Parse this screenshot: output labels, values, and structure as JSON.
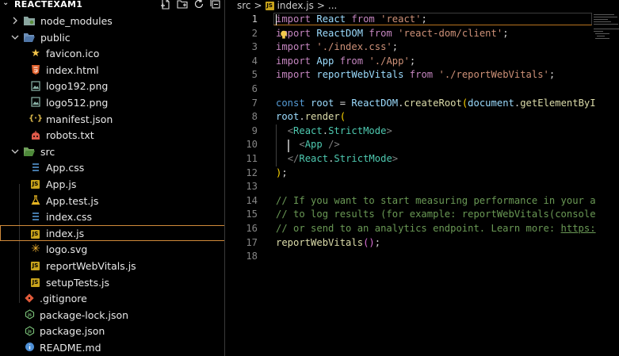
{
  "explorer": {
    "title": "REACTEXAM1",
    "actions": [
      "new-file-icon",
      "new-folder-icon",
      "refresh-icon",
      "collapse-all-icon"
    ],
    "items": [
      {
        "label": "node_modules",
        "kind": "folder",
        "state": "collapsed",
        "depth": 0
      },
      {
        "label": "public",
        "kind": "folder",
        "state": "expanded",
        "depth": 0
      },
      {
        "label": "favicon.ico",
        "kind": "file",
        "icon": "star-icon",
        "depth": 1
      },
      {
        "label": "index.html",
        "kind": "file",
        "icon": "html-icon",
        "depth": 1
      },
      {
        "label": "logo192.png",
        "kind": "file",
        "icon": "image-icon",
        "depth": 1
      },
      {
        "label": "logo512.png",
        "kind": "file",
        "icon": "image-icon",
        "depth": 1
      },
      {
        "label": "manifest.json",
        "kind": "file",
        "icon": "json-icon",
        "depth": 1
      },
      {
        "label": "robots.txt",
        "kind": "file",
        "icon": "robot-icon",
        "depth": 1
      },
      {
        "label": "src",
        "kind": "folder",
        "state": "expanded",
        "depth": 0
      },
      {
        "label": "App.css",
        "kind": "file",
        "icon": "css-icon",
        "depth": 1
      },
      {
        "label": "App.js",
        "kind": "file",
        "icon": "js-icon",
        "depth": 1
      },
      {
        "label": "App.test.js",
        "kind": "file",
        "icon": "test-icon",
        "depth": 1
      },
      {
        "label": "index.css",
        "kind": "file",
        "icon": "css-icon",
        "depth": 1
      },
      {
        "label": "index.js",
        "kind": "file",
        "icon": "js-icon",
        "depth": 1,
        "selected": true
      },
      {
        "label": "logo.svg",
        "kind": "file",
        "icon": "svg-icon",
        "depth": 1
      },
      {
        "label": "reportWebVitals.js",
        "kind": "file",
        "icon": "js-icon",
        "depth": 1
      },
      {
        "label": "setupTests.js",
        "kind": "file",
        "icon": "js-icon",
        "depth": 1
      },
      {
        "label": ".gitignore",
        "kind": "file",
        "icon": "git-icon",
        "depth": 0
      },
      {
        "label": "package-lock.json",
        "kind": "file",
        "icon": "npm-icon",
        "depth": 0
      },
      {
        "label": "package.json",
        "kind": "file",
        "icon": "npm-icon",
        "depth": 0
      },
      {
        "label": "README.md",
        "kind": "file",
        "icon": "info-icon",
        "depth": 0
      }
    ]
  },
  "breadcrumb": {
    "folder": "src",
    "separator": ">",
    "badge": "JS",
    "file": "index.js",
    "tail": "..."
  },
  "editor": {
    "active_line": 1,
    "lines": [
      {
        "n": "1",
        "tokens": [
          [
            "kw",
            "import"
          ],
          [
            "punc",
            " "
          ],
          [
            "id",
            "React"
          ],
          [
            "punc",
            " "
          ],
          [
            "kw",
            "from"
          ],
          [
            "punc",
            " "
          ],
          [
            "str",
            "'react'"
          ],
          [
            "punc",
            ";"
          ]
        ]
      },
      {
        "n": "2",
        "tokens": [
          [
            "kw",
            "import"
          ],
          [
            "punc",
            " "
          ],
          [
            "id",
            "ReactDOM"
          ],
          [
            "punc",
            " "
          ],
          [
            "kw",
            "from"
          ],
          [
            "punc",
            " "
          ],
          [
            "str",
            "'react-dom/client'"
          ],
          [
            "punc",
            ";"
          ]
        ]
      },
      {
        "n": "3",
        "tokens": [
          [
            "kw",
            "import"
          ],
          [
            "punc",
            " "
          ],
          [
            "str",
            "'./index.css'"
          ],
          [
            "punc",
            ";"
          ]
        ]
      },
      {
        "n": "4",
        "tokens": [
          [
            "kw",
            "import"
          ],
          [
            "punc",
            " "
          ],
          [
            "id",
            "App"
          ],
          [
            "punc",
            " "
          ],
          [
            "kw",
            "from"
          ],
          [
            "punc",
            " "
          ],
          [
            "str",
            "'./App'"
          ],
          [
            "punc",
            ";"
          ]
        ]
      },
      {
        "n": "5",
        "tokens": [
          [
            "kw",
            "import"
          ],
          [
            "punc",
            " "
          ],
          [
            "id",
            "reportWebVitals"
          ],
          [
            "punc",
            " "
          ],
          [
            "kw",
            "from"
          ],
          [
            "punc",
            " "
          ],
          [
            "str",
            "'./reportWebVitals'"
          ],
          [
            "punc",
            ";"
          ]
        ]
      },
      {
        "n": "6",
        "tokens": []
      },
      {
        "n": "7",
        "tokens": [
          [
            "decl",
            "const"
          ],
          [
            "punc",
            " "
          ],
          [
            "id",
            "root"
          ],
          [
            "punc",
            " = "
          ],
          [
            "id",
            "ReactDOM"
          ],
          [
            "punc",
            "."
          ],
          [
            "fn",
            "createRoot"
          ],
          [
            "br",
            "("
          ],
          [
            "id",
            "document"
          ],
          [
            "punc",
            "."
          ],
          [
            "fn",
            "getElementByI"
          ]
        ]
      },
      {
        "n": "8",
        "tokens": [
          [
            "id",
            "root"
          ],
          [
            "punc",
            "."
          ],
          [
            "fn",
            "render"
          ],
          [
            "br",
            "("
          ]
        ]
      },
      {
        "n": "9",
        "tokens": [
          [
            "punc",
            "  "
          ],
          [
            "tag",
            "<"
          ],
          [
            "cls",
            "React"
          ],
          [
            "punc",
            "."
          ],
          [
            "cls",
            "StrictMode"
          ],
          [
            "tag",
            ">"
          ]
        ]
      },
      {
        "n": "10",
        "tokens": [
          [
            "punc",
            "    "
          ],
          [
            "tag",
            "<"
          ],
          [
            "cls",
            "App"
          ],
          [
            "punc",
            " "
          ],
          [
            "tag",
            "/>"
          ]
        ]
      },
      {
        "n": "11",
        "tokens": [
          [
            "punc",
            "  "
          ],
          [
            "tag",
            "</"
          ],
          [
            "cls",
            "React"
          ],
          [
            "punc",
            "."
          ],
          [
            "cls",
            "StrictMode"
          ],
          [
            "tag",
            ">"
          ]
        ]
      },
      {
        "n": "12",
        "tokens": [
          [
            "br",
            ")"
          ],
          [
            "punc",
            ";"
          ]
        ]
      },
      {
        "n": "13",
        "tokens": []
      },
      {
        "n": "14",
        "tokens": [
          [
            "cmt",
            "// If you want to start measuring performance in your a"
          ]
        ]
      },
      {
        "n": "15",
        "tokens": [
          [
            "cmt",
            "// to log results (for example: reportWebVitals(console"
          ]
        ]
      },
      {
        "n": "16",
        "tokens": [
          [
            "cmt",
            "// or send to an analytics endpoint. Learn more: "
          ],
          [
            "lnk",
            "https:"
          ]
        ]
      },
      {
        "n": "17",
        "tokens": [
          [
            "fn",
            "reportWebVitals"
          ],
          [
            "br2",
            "("
          ],
          [
            "br2",
            ")"
          ],
          [
            "punc",
            ";"
          ]
        ]
      },
      {
        "n": "18",
        "tokens": []
      }
    ]
  },
  "colors": {
    "selection_border": "#d08a3a",
    "js_badge": "#c9a41c"
  }
}
